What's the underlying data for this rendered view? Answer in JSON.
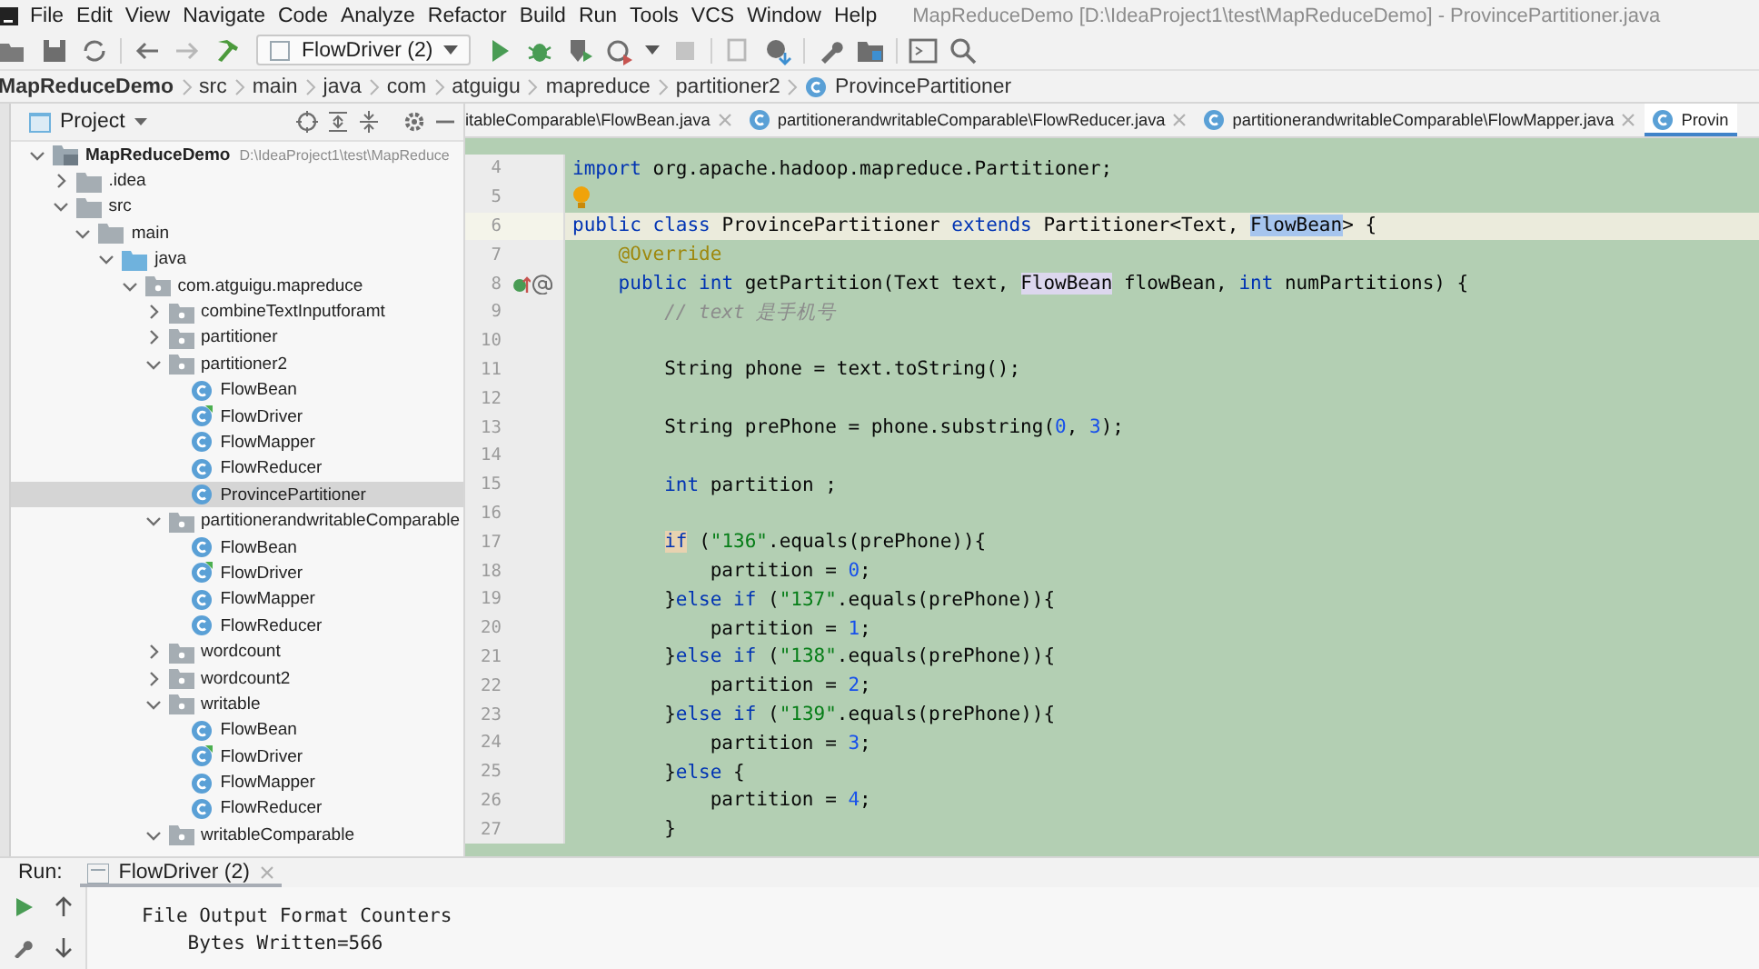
{
  "window": {
    "title": "MapReduceDemo [D:\\IdeaProject1\\test\\MapReduceDemo] - ProvincePartitioner.java"
  },
  "menu": [
    "File",
    "Edit",
    "View",
    "Navigate",
    "Code",
    "Analyze",
    "Refactor",
    "Build",
    "Run",
    "Tools",
    "VCS",
    "Window",
    "Help"
  ],
  "toolbar": {
    "run_config": "FlowDriver (2)"
  },
  "breadcrumbs": [
    "MapReduceDemo",
    "src",
    "main",
    "java",
    "com",
    "atguigu",
    "mapreduce",
    "partitioner2",
    "ProvincePartitioner"
  ],
  "project_panel": {
    "title": "Project",
    "tree": [
      {
        "label": "MapReduceDemo",
        "path": "D:\\IdeaProject1\\test\\MapReduce",
        "kind": "project",
        "expanded": true,
        "selected": false,
        "children": [
          {
            "label": ".idea",
            "kind": "folder",
            "expanded": false,
            "selected": false
          },
          {
            "label": "src",
            "kind": "folder",
            "expanded": true,
            "selected": false,
            "children": [
              {
                "label": "main",
                "kind": "folder",
                "expanded": true,
                "selected": false,
                "children": [
                  {
                    "label": "java",
                    "kind": "source-root",
                    "expanded": true,
                    "selected": false,
                    "children": [
                      {
                        "label": "com.atguigu.mapreduce",
                        "kind": "package",
                        "expanded": true,
                        "selected": false,
                        "children": [
                          {
                            "label": "combineTextInputforamt",
                            "kind": "package",
                            "expanded": false,
                            "selected": false
                          },
                          {
                            "label": "partitioner",
                            "kind": "package",
                            "expanded": false,
                            "selected": false
                          },
                          {
                            "label": "partitioner2",
                            "kind": "package",
                            "expanded": true,
                            "selected": false,
                            "children": [
                              {
                                "label": "FlowBean",
                                "kind": "class",
                                "selected": false
                              },
                              {
                                "label": "FlowDriver",
                                "kind": "main-class",
                                "selected": false
                              },
                              {
                                "label": "FlowMapper",
                                "kind": "class",
                                "selected": false
                              },
                              {
                                "label": "FlowReducer",
                                "kind": "class",
                                "selected": false
                              },
                              {
                                "label": "ProvincePartitioner",
                                "kind": "class",
                                "selected": true
                              }
                            ]
                          },
                          {
                            "label": "partitionerandwritableComparable",
                            "kind": "package",
                            "expanded": true,
                            "selected": false,
                            "children": [
                              {
                                "label": "FlowBean",
                                "kind": "class",
                                "selected": false
                              },
                              {
                                "label": "FlowDriver",
                                "kind": "main-class",
                                "selected": false
                              },
                              {
                                "label": "FlowMapper",
                                "kind": "class",
                                "selected": false
                              },
                              {
                                "label": "FlowReducer",
                                "kind": "class",
                                "selected": false
                              }
                            ]
                          },
                          {
                            "label": "wordcount",
                            "kind": "package",
                            "expanded": false,
                            "selected": false
                          },
                          {
                            "label": "wordcount2",
                            "kind": "package",
                            "expanded": false,
                            "selected": false
                          },
                          {
                            "label": "writable",
                            "kind": "package",
                            "expanded": true,
                            "selected": false,
                            "children": [
                              {
                                "label": "FlowBean",
                                "kind": "class",
                                "selected": false
                              },
                              {
                                "label": "FlowDriver",
                                "kind": "main-class",
                                "selected": false
                              },
                              {
                                "label": "FlowMapper",
                                "kind": "class",
                                "selected": false
                              },
                              {
                                "label": "FlowReducer",
                                "kind": "class",
                                "selected": false
                              }
                            ]
                          },
                          {
                            "label": "writableComparable",
                            "kind": "package",
                            "expanded": true,
                            "selected": false
                          }
                        ]
                      }
                    ]
                  }
                ]
              }
            ]
          }
        ]
      }
    ]
  },
  "editor": {
    "tabs": [
      {
        "label": "itableComparable\\FlowBean.java",
        "selected": false
      },
      {
        "label": "partitionerandwritableComparable\\FlowReducer.java",
        "selected": false
      },
      {
        "label": "partitionerandwritableComparable\\FlowMapper.java",
        "selected": false
      },
      {
        "label": "Provin",
        "selected": true
      }
    ],
    "lines": [
      {
        "number": "4",
        "tokens": [
          {
            "kind": "keyword",
            "text": "import "
          },
          {
            "kind": "plain",
            "text": "org.apache.hadoop.mapreduce.Partitioner;"
          }
        ]
      },
      {
        "number": "5",
        "markers": [
          {
            "kind": "bulb"
          }
        ]
      },
      {
        "number": "6",
        "current": true,
        "tokens": [
          {
            "kind": "keyword",
            "text": "public class "
          },
          {
            "kind": "plain",
            "text": "ProvincePartitioner "
          },
          {
            "kind": "keyword",
            "text": "extends "
          },
          {
            "kind": "plain",
            "text": "Partitioner<Text, "
          },
          {
            "kind": "selection",
            "text": "FlowBean"
          },
          {
            "kind": "plain",
            "text": "> {"
          }
        ]
      },
      {
        "number": "7",
        "tokens": [
          {
            "kind": "annotation",
            "text": "    @Override"
          }
        ]
      },
      {
        "number": "8",
        "markers": [
          {
            "kind": "implements"
          },
          {
            "kind": "override"
          }
        ],
        "tokens": [
          {
            "kind": "keyword",
            "text": "    public int "
          },
          {
            "kind": "plain",
            "text": "getPartition(Text text, "
          },
          {
            "kind": "usage",
            "text": "FlowBean"
          },
          {
            "kind": "plain",
            "text": " flowBean, "
          },
          {
            "kind": "keyword",
            "text": "int "
          },
          {
            "kind": "plain",
            "text": "numPartitions) {"
          }
        ]
      },
      {
        "number": "9",
        "tokens": [
          {
            "kind": "comment",
            "text": "        // text 是手机号"
          }
        ]
      },
      {
        "number": "10"
      },
      {
        "number": "11",
        "tokens": [
          {
            "kind": "plain",
            "text": "        String phone = text.toString();"
          }
        ]
      },
      {
        "number": "12"
      },
      {
        "number": "13",
        "tokens": [
          {
            "kind": "plain",
            "text": "        String prePhone = phone.substring("
          },
          {
            "kind": "number",
            "text": "0"
          },
          {
            "kind": "plain",
            "text": ", "
          },
          {
            "kind": "number",
            "text": "3"
          },
          {
            "kind": "plain",
            "text": ");"
          }
        ]
      },
      {
        "number": "14"
      },
      {
        "number": "15",
        "tokens": [
          {
            "kind": "keyword",
            "text": "        int "
          },
          {
            "kind": "plain",
            "text": "partition ;"
          }
        ]
      },
      {
        "number": "16"
      },
      {
        "number": "17",
        "tokens": [
          {
            "kind": "keyword-match",
            "text": "        if"
          },
          {
            "kind": "plain",
            "text": " ("
          },
          {
            "kind": "string",
            "text": "\"136\""
          },
          {
            "kind": "plain",
            "text": ".equals(prePhone)){"
          }
        ]
      },
      {
        "number": "18",
        "tokens": [
          {
            "kind": "plain",
            "text": "            partition = "
          },
          {
            "kind": "number",
            "text": "0"
          },
          {
            "kind": "plain",
            "text": ";"
          }
        ]
      },
      {
        "number": "19",
        "tokens": [
          {
            "kind": "plain",
            "text": "        }"
          },
          {
            "kind": "keyword",
            "text": "else if "
          },
          {
            "kind": "plain",
            "text": "("
          },
          {
            "kind": "string",
            "text": "\"137\""
          },
          {
            "kind": "plain",
            "text": ".equals(prePhone)){"
          }
        ]
      },
      {
        "number": "20",
        "tokens": [
          {
            "kind": "plain",
            "text": "            partition = "
          },
          {
            "kind": "number",
            "text": "1"
          },
          {
            "kind": "plain",
            "text": ";"
          }
        ]
      },
      {
        "number": "21",
        "tokens": [
          {
            "kind": "plain",
            "text": "        }"
          },
          {
            "kind": "keyword",
            "text": "else if "
          },
          {
            "kind": "plain",
            "text": "("
          },
          {
            "kind": "string",
            "text": "\"138\""
          },
          {
            "kind": "plain",
            "text": ".equals(prePhone)){"
          }
        ]
      },
      {
        "number": "22",
        "tokens": [
          {
            "kind": "plain",
            "text": "            partition = "
          },
          {
            "kind": "number",
            "text": "2"
          },
          {
            "kind": "plain",
            "text": ";"
          }
        ]
      },
      {
        "number": "23",
        "tokens": [
          {
            "kind": "plain",
            "text": "        }"
          },
          {
            "kind": "keyword",
            "text": "else if "
          },
          {
            "kind": "plain",
            "text": "("
          },
          {
            "kind": "string",
            "text": "\"139\""
          },
          {
            "kind": "plain",
            "text": ".equals(prePhone)){"
          }
        ]
      },
      {
        "number": "24",
        "tokens": [
          {
            "kind": "plain",
            "text": "            partition = "
          },
          {
            "kind": "number",
            "text": "3"
          },
          {
            "kind": "plain",
            "text": ";"
          }
        ]
      },
      {
        "number": "25",
        "tokens": [
          {
            "kind": "plain",
            "text": "        }"
          },
          {
            "kind": "keyword",
            "text": "else "
          },
          {
            "kind": "plain",
            "text": "{"
          }
        ]
      },
      {
        "number": "26",
        "tokens": [
          {
            "kind": "plain",
            "text": "            partition = "
          },
          {
            "kind": "number",
            "text": "4"
          },
          {
            "kind": "plain",
            "text": ";"
          }
        ]
      },
      {
        "number": "27",
        "tokens": [
          {
            "kind": "plain",
            "text": "        }"
          }
        ]
      }
    ]
  },
  "run_panel": {
    "label": "Run:",
    "tab": "FlowDriver (2)",
    "output": [
      "File Output Format Counters",
      "    Bytes Written=566"
    ]
  }
}
